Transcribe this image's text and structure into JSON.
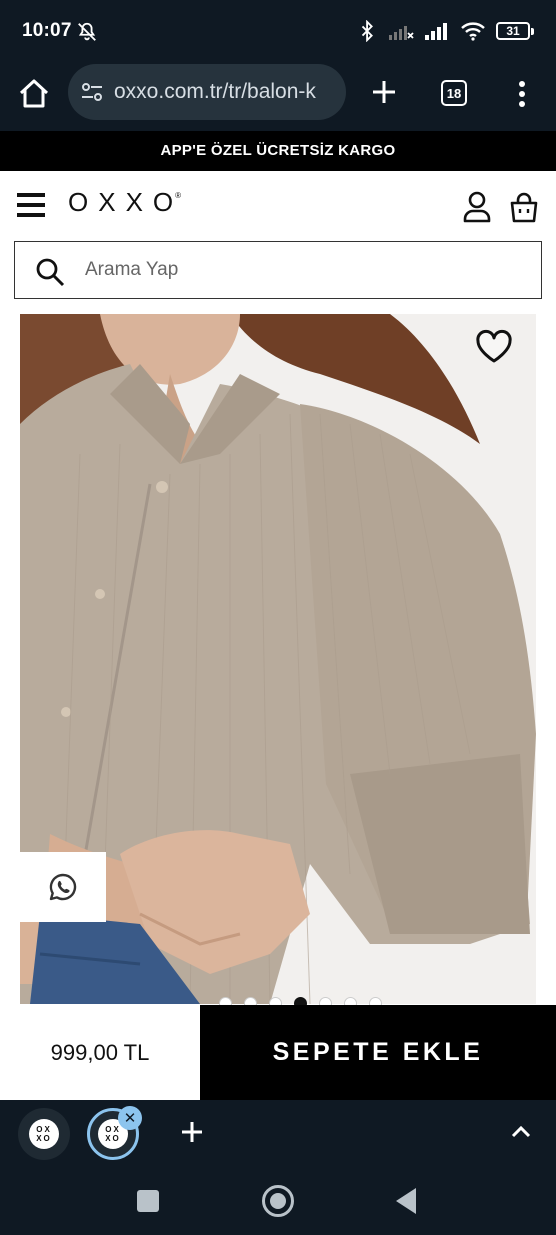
{
  "status_bar": {
    "time": "10:07",
    "battery": "31"
  },
  "browser": {
    "url": "oxxo.com.tr/tr/balon-k",
    "tab_count": "18"
  },
  "promo": {
    "text": "APP'E ÖZEL ÜCRETSİZ KARGO"
  },
  "header": {
    "logo": "OXXO",
    "logo_mark": "®"
  },
  "search": {
    "placeholder": "Arama Yap"
  },
  "product": {
    "image_count": 7,
    "active_image_index": 4,
    "price": "999,00 TL",
    "add_to_cart_label": "SEPETE EKLE"
  },
  "tabs": {
    "thumb_logo_line1": "OX",
    "thumb_logo_line2": "XO"
  },
  "colors": {
    "chrome_bg": "#0f1923",
    "url_pill": "#26333d",
    "accent_tab": "#8cc4ee",
    "shirt": "#b8ab9c",
    "hair": "#7a4a30"
  },
  "icons": [
    "home-icon",
    "tune-icon",
    "plus-icon",
    "more-vert-icon",
    "menu-icon",
    "user-icon",
    "bag-icon",
    "search-icon",
    "heart-icon",
    "whatsapp-icon",
    "chevron-up-icon"
  ]
}
